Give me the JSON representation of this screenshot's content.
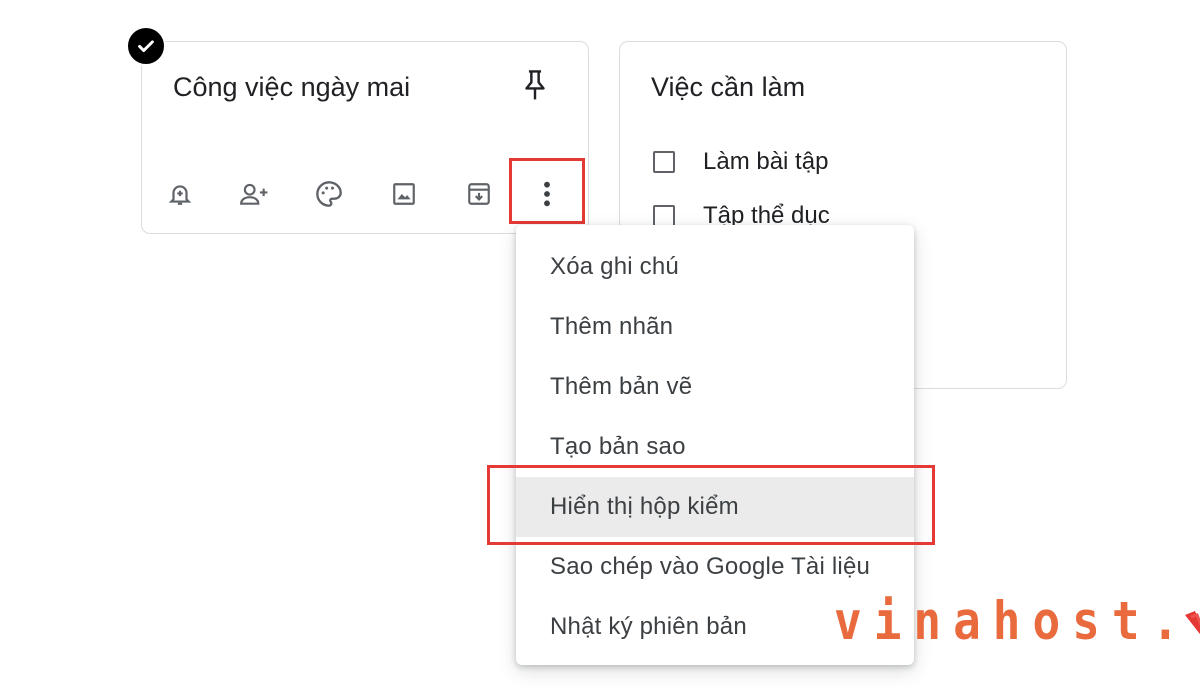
{
  "note1": {
    "title": "Công việc ngày mai",
    "pin_icon": "pin-icon",
    "toolbar": [
      {
        "name": "remind-icon"
      },
      {
        "name": "collaborator-icon"
      },
      {
        "name": "palette-icon"
      },
      {
        "name": "image-icon"
      },
      {
        "name": "archive-icon"
      },
      {
        "name": "more-vert-icon"
      }
    ]
  },
  "note2": {
    "title": "Việc cần làm",
    "items": [
      {
        "label": "Làm bài tập",
        "checked": false
      },
      {
        "label": "Tập thể dục",
        "checked": false
      }
    ]
  },
  "menu": {
    "items": [
      {
        "label": "Xóa ghi chú"
      },
      {
        "label": "Thêm nhãn"
      },
      {
        "label": "Thêm bản vẽ"
      },
      {
        "label": "Tạo bản sao"
      },
      {
        "label": "Hiển thị hộp kiểm"
      },
      {
        "label": "Sao chép vào Google Tài liệu"
      },
      {
        "label": "Nhật ký phiên bản"
      }
    ],
    "highlighted_index": 4
  },
  "watermark": {
    "text": "vinahost."
  },
  "colors": {
    "highlight_border": "#e53935",
    "logo": "#e96a3d",
    "menu_hover": "#ebebeb",
    "icon": "#5f6368"
  }
}
